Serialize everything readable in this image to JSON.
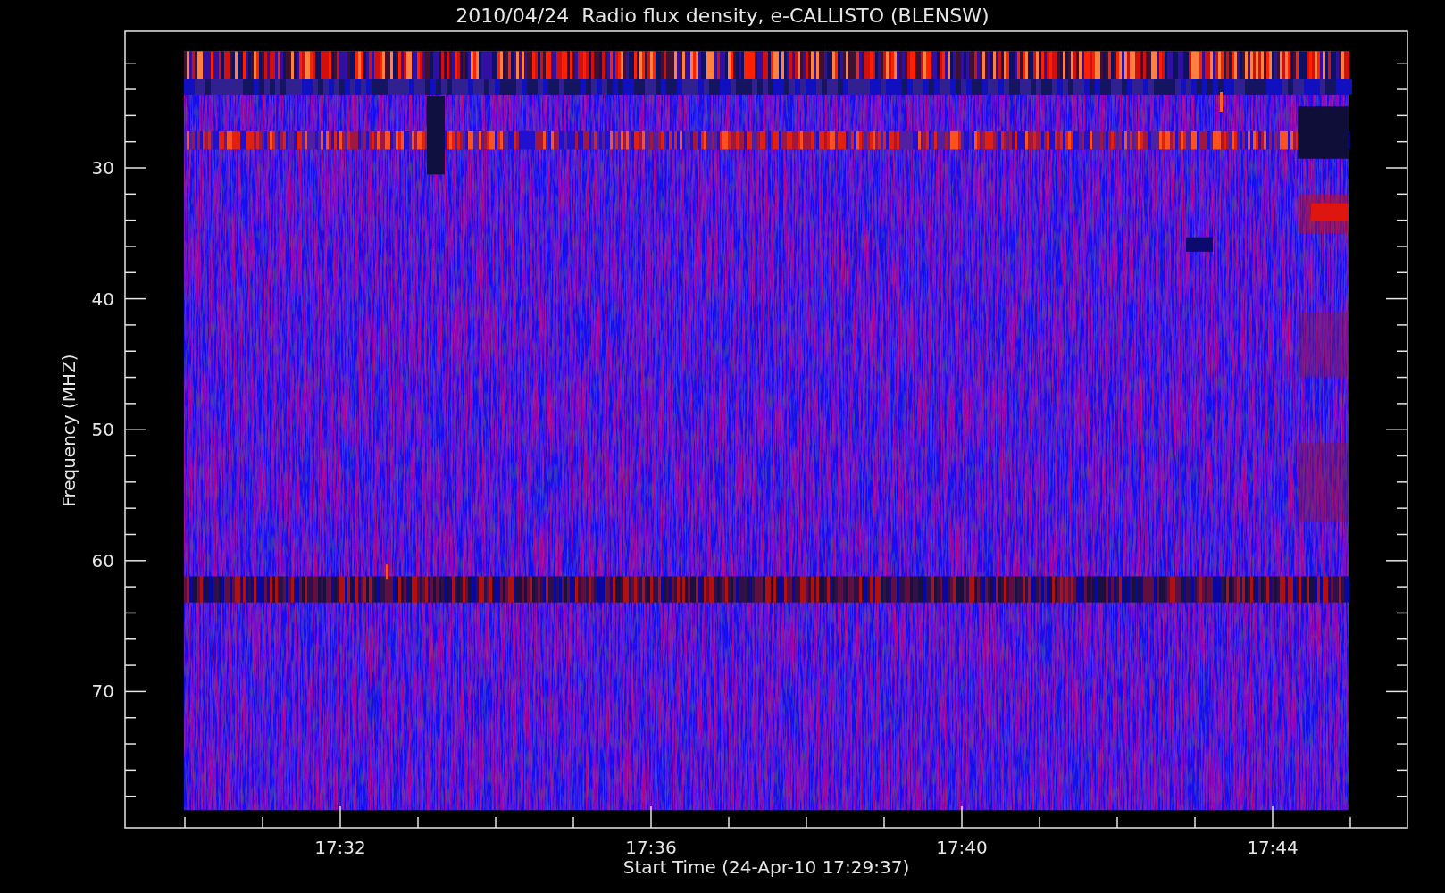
{
  "title": "2010/04/24  Radio flux density, e-CALLISTO (BLENSW)",
  "y_axis": {
    "label": "Frequency (MHZ)",
    "ticks": [
      "30",
      "40",
      "50",
      "60",
      "70"
    ]
  },
  "x_axis": {
    "label": "Start Time (24-Apr-10 17:29:37)",
    "ticks": [
      "17:32",
      "17:36",
      "17:40",
      "17:44"
    ]
  }
}
